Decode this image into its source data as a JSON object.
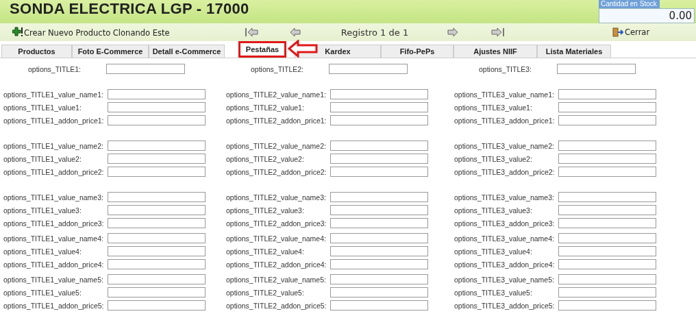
{
  "header": {
    "title": "SONDA ELECTRICA LGP - 17000",
    "stock_label": "Cantidad en Stock",
    "stock_value": "0.00"
  },
  "toolbar": {
    "clone_label": "Crear Nuevo Producto Clonando Este",
    "record": "Registro 1 de 1",
    "close_label": "Cerrar"
  },
  "tabs": [
    {
      "label": "Productos",
      "selected": false
    },
    {
      "label": "Foto E-Commerce",
      "selected": false
    },
    {
      "label": "Detall e-Commerce",
      "selected": false
    },
    {
      "label": "Pestañas",
      "selected": true
    },
    {
      "label": "Kardex",
      "selected": false
    },
    {
      "label": "Fifo-PePs",
      "selected": false
    },
    {
      "label": "Ajustes NIIF",
      "selected": false
    },
    {
      "label": "Lista Materiales",
      "selected": false
    }
  ],
  "title_fields": [
    "options_TITLE1:",
    "options_TITLE2:",
    "options_TITLE3:"
  ],
  "groups": [
    {
      "rows": [
        [
          "options_TITLE1_value_name1:",
          "options_TITLE2_value_name1:",
          "options_TITLE3_value_name1:"
        ],
        [
          "options_TITLE1_value1:",
          "options_TITLE2_value1:",
          "options_TITLE3_value1:"
        ],
        [
          "options_TITLE1_addon_price1:",
          "options_TITLE2_addon_price1:",
          "options_TITLE3_addon_price1:"
        ]
      ]
    },
    {
      "rows": [
        [
          "options_TITLE1_value_name2:",
          "options_TITLE2_value_name2:",
          "options_TITLE3_value_name2:"
        ],
        [
          "options_TITLE1_value2:",
          "options_TITLE2_value2:",
          "options_TITLE3_value2:"
        ],
        [
          "options_TITLE1_addon_price2:",
          "options_TITLE2_addon_price2:",
          "options_TITLE3_addon_price2:"
        ]
      ]
    },
    {
      "rows": [
        [
          "options_TITLE1_value_name3:",
          "options_TITLE2_value_name3:",
          "options_TITLE3_value_name3:"
        ],
        [
          "options_TITLE1_value3:",
          "options_TITLE2_value3:",
          "options_TITLE3_value3:"
        ],
        [
          "options_TITLE1_addon_price3:",
          "options_TITLE2_addon_price3:",
          "options_TITLE3_addon_price3:"
        ]
      ]
    },
    {
      "rows": [
        [
          "options_TITLE1_value_name4:",
          "options_TITLE2_value_name4:",
          "options_TITLE3_value_name4:"
        ],
        [
          "options_TITLE1_value4:",
          "options_TITLE2_value4:",
          "options_TITLE3_value4:"
        ],
        [
          "options_TITLE1_addon_price4:",
          "options_TITLE2_addon_price4:",
          "options_TITLE3_addon_price4:"
        ]
      ]
    },
    {
      "rows": [
        [
          "options_TITLE1_value_name5:",
          "options_TITLE2_value_name5:",
          "options_TITLE3_value_name5:"
        ],
        [
          "options_TITLE1_value5:",
          "options_TITLE2_value5:",
          "options_TITLE3_value5:"
        ],
        [
          "options_TITLE1_addon_price5:",
          "options_TITLE2_addon_price5:",
          "options_TITLE3_addon_price5:"
        ]
      ]
    }
  ]
}
